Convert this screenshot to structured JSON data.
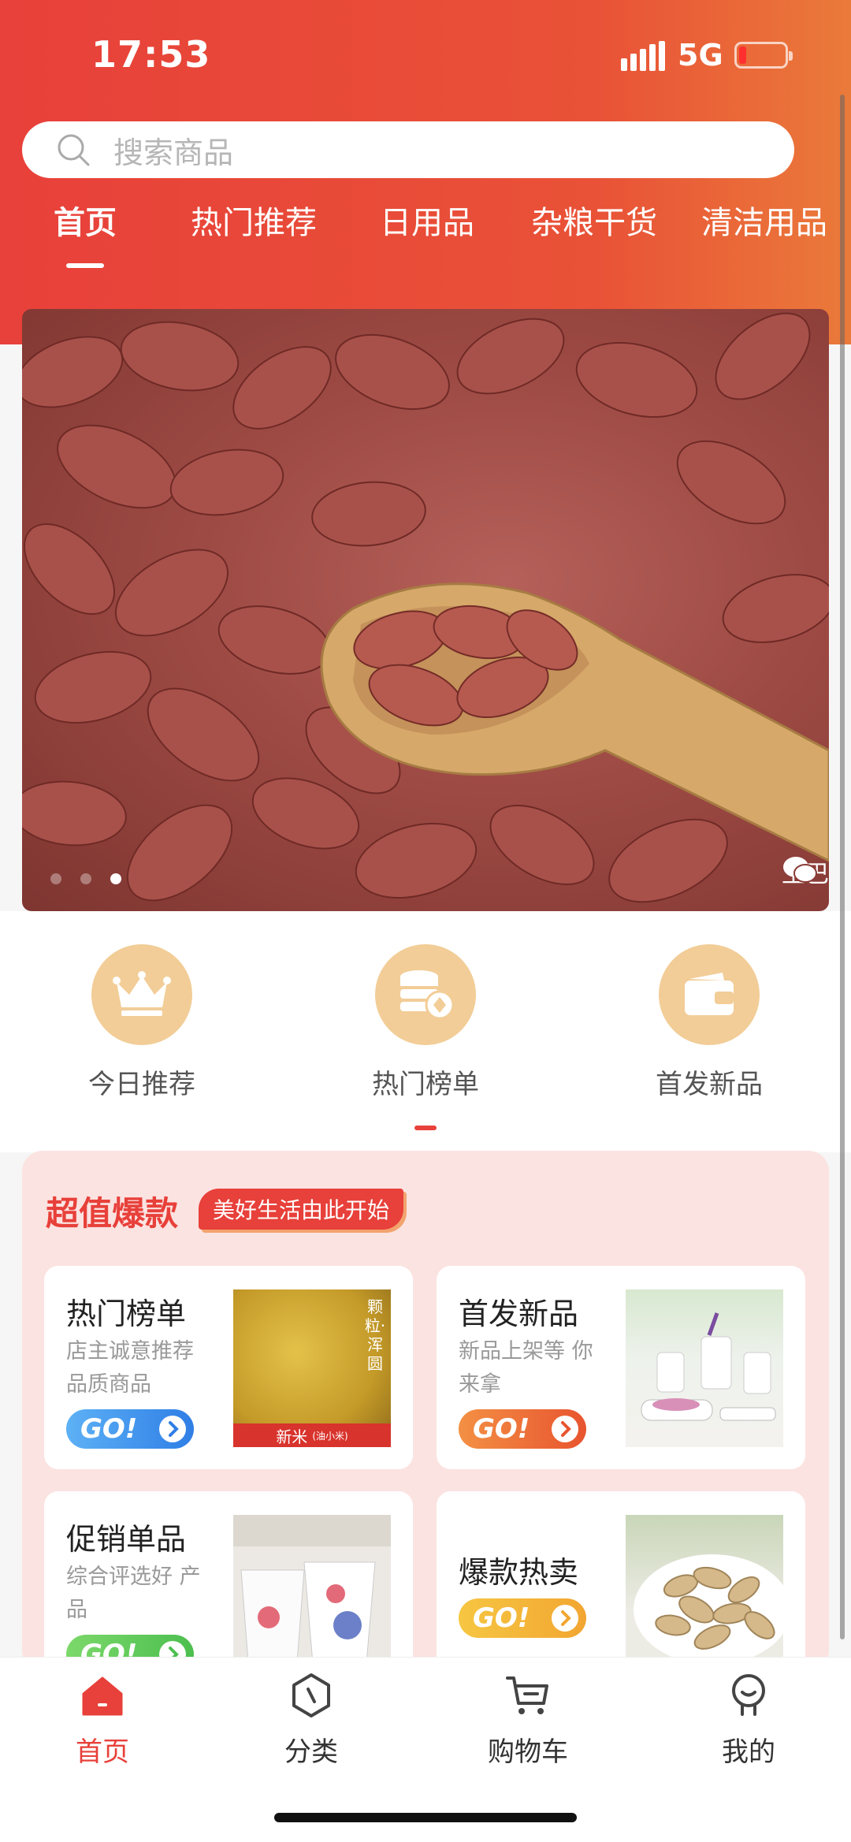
{
  "status": {
    "time": "17:53",
    "network": "5G"
  },
  "search": {
    "placeholder": "搜索商品"
  },
  "tabs": [
    {
      "label": "首页",
      "active": true
    },
    {
      "label": "热门推荐"
    },
    {
      "label": "日用品"
    },
    {
      "label": "杂粮干货"
    },
    {
      "label": "清洁用品"
    }
  ],
  "banner": {
    "watermark": "土巴",
    "slide_count": 3,
    "active_slide": 3
  },
  "quick": [
    {
      "label": "今日推荐",
      "icon": "crown-icon"
    },
    {
      "label": "热门榜单",
      "icon": "coins-icon"
    },
    {
      "label": "首发新品",
      "icon": "wallet-icon"
    }
  ],
  "deals": {
    "title": "超值爆款",
    "tag": "美好生活由此开始",
    "cards": [
      {
        "title": "热门榜单",
        "sub": "店主诚意推荐品质商品",
        "go": "GO!",
        "img_label": "新米",
        "img_label_small": "(油小米)",
        "img_side": "颗粒·浑圆"
      },
      {
        "title": "首发新品",
        "sub": "新品上架等 你来拿",
        "go": "GO!"
      },
      {
        "title": "促销单品",
        "sub": "综合评选好 产品",
        "go": "GO!"
      },
      {
        "title": "爆款热卖",
        "sub": "",
        "go": "GO!"
      }
    ]
  },
  "nav": [
    {
      "label": "首页",
      "icon": "home-icon",
      "active": true
    },
    {
      "label": "分类",
      "icon": "category-icon"
    },
    {
      "label": "购物车",
      "icon": "cart-icon"
    },
    {
      "label": "我的",
      "icon": "profile-icon"
    }
  ],
  "colors": {
    "primary": "#e8403a",
    "accent": "#ea7a3a",
    "quick_circle": "#f2cd97",
    "deals_bg": "#fbe3e1"
  }
}
